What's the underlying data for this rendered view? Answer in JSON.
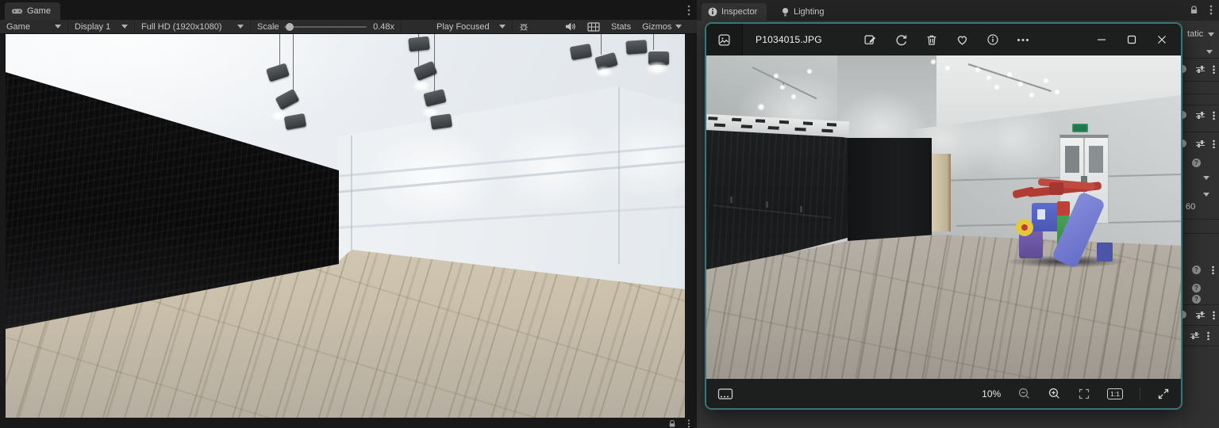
{
  "unity": {
    "game_panel": {
      "tab_label": "Game",
      "toolbar": {
        "display_mode": "Game",
        "display_target": "Display 1",
        "resolution": "Full HD (1920x1080)",
        "scale_label": "Scale",
        "scale_value": "0.48x",
        "play_mode": "Play Focused",
        "stats_label": "Stats",
        "gizmos_label": "Gizmos"
      }
    },
    "inspector_panel": {
      "tab_inspector": "Inspector",
      "tab_lighting": "Lighting",
      "static_label_partial": "tatic",
      "field_value_partial": "60"
    }
  },
  "photos_app": {
    "title": "P1034015.JPG",
    "statusbar": {
      "zoom_percent": "10%",
      "actual_size_label": "1:1"
    }
  },
  "colors": {
    "accent_teal": "#3b7575",
    "unity_background": "#191919",
    "unity_toolbar": "#2b2b2b",
    "photos_chrome": "#1d1e1e",
    "scene_black_wall": "#0b0b0c",
    "scene_wood_floor": "#d5cab4",
    "photo_wood_floor": "#b3aca1"
  }
}
